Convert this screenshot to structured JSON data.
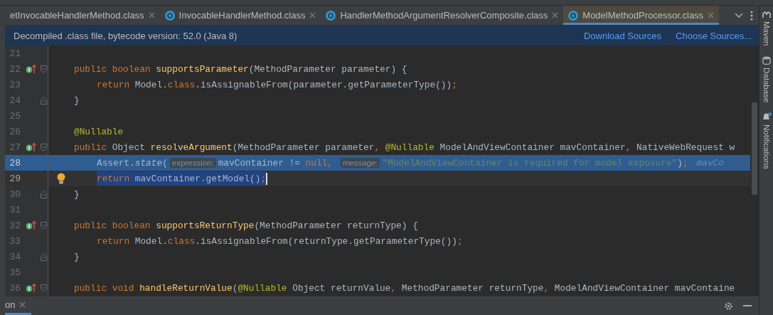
{
  "tabs": [
    {
      "label": "etInvocableHandlerMethod.class",
      "icon": false,
      "selected": false
    },
    {
      "label": "InvocableHandlerMethod.class",
      "icon": true,
      "selected": false
    },
    {
      "label": "HandlerMethodArgumentResolverComposite.class",
      "icon": true,
      "selected": false
    },
    {
      "label": "ModelMethodProcessor.class",
      "icon": true,
      "selected": true
    }
  ],
  "banner": {
    "text": "Decompiled .class file, bytecode version: 52.0 (Java 8)",
    "links": [
      "Download Sources",
      "Choose Sources..."
    ]
  },
  "lines": [
    {
      "number": "21",
      "kind": "plain",
      "override": false,
      "bulb": false,
      "selected": false,
      "caret": false
    },
    {
      "number": "22",
      "kind": "fold-start",
      "override": true,
      "bulb": false,
      "selected": false,
      "caret": false,
      "tokens": [
        {
          "kind": "kw",
          "text": "public boolean "
        },
        {
          "kind": "fn",
          "text": "supportsParameter"
        },
        {
          "kind": "plain",
          "text": "(MethodParameter parameter) {"
        }
      ],
      "children": [
        {
          "number": "23",
          "kind": "plain",
          "override": false,
          "bulb": false,
          "selected": false,
          "caret": false,
          "tokens": [
            {
              "kind": "kw",
              "text": "return "
            },
            {
              "kind": "plain",
              "text": "Model."
            },
            {
              "kind": "kw",
              "text": "class"
            },
            {
              "kind": "plain",
              "text": ".isAssignableFrom(parameter.getParameterType())"
            },
            {
              "kind": "kw",
              "text": ";"
            }
          ]
        }
      ]
    },
    {
      "number": "24",
      "kind": "fold-end",
      "override": false,
      "bulb": false,
      "selected": false,
      "caret": false,
      "tokens": [
        {
          "kind": "plain",
          "text": "}"
        }
      ]
    },
    {
      "number": "25",
      "kind": "plain",
      "override": false,
      "bulb": false,
      "selected": false,
      "caret": false
    },
    {
      "number": "26",
      "kind": "plain",
      "override": false,
      "bulb": false,
      "selected": false,
      "caret": false,
      "tokens": [
        {
          "kind": "ann",
          "text": "@Nullable"
        }
      ]
    },
    {
      "number": "27",
      "kind": "fold-start",
      "override": true,
      "bulb": false,
      "selected": false,
      "caret": false,
      "tokens": [
        {
          "kind": "kw",
          "text": "public "
        },
        {
          "kind": "plain",
          "text": "Object "
        },
        {
          "kind": "fn",
          "text": "resolveArgument"
        },
        {
          "kind": "plain",
          "text": "(MethodParameter parameter"
        },
        {
          "kind": "kw",
          "text": ", "
        },
        {
          "kind": "ann",
          "text": "@Nullable "
        },
        {
          "kind": "plain",
          "text": "ModelAndViewContainer mavContainer"
        },
        {
          "kind": "kw",
          "text": ", "
        },
        {
          "kind": "plain",
          "text": "NativeWebRequest w"
        }
      ],
      "children": [
        {
          "number": "28",
          "kind": "plain",
          "override": false,
          "bulb": false,
          "selected": true,
          "caret": false,
          "tokens": [
            {
              "kind": "plain",
              "text": "Assert."
            },
            {
              "kind": "static",
              "text": "state"
            },
            {
              "kind": "plain",
              "text": "("
            },
            {
              "kind": "hint",
              "text": "expression:"
            },
            {
              "kind": "plain",
              "text": "mavContainer != "
            },
            {
              "kind": "kw",
              "text": "null, "
            },
            {
              "kind": "hint",
              "text": "message:"
            },
            {
              "kind": "str",
              "text": "\"ModelAndViewContainer is required for model exposure\""
            },
            {
              "kind": "plain",
              "text": ")"
            },
            {
              "kind": "kw",
              "text": ";"
            },
            {
              "kind": "value",
              "text": "mavCo"
            }
          ]
        },
        {
          "number": "29",
          "kind": "plain",
          "override": false,
          "bulb": true,
          "selected": false,
          "caret": true,
          "tokens": [
            {
              "kind": "kw",
              "text": "return "
            },
            {
              "kind": "plain",
              "text": "mavContainer.getModel()"
            },
            {
              "kind": "kw",
              "text": ";"
            }
          ]
        }
      ]
    },
    {
      "number": "30",
      "kind": "fold-end",
      "override": false,
      "bulb": false,
      "selected": false,
      "caret": false,
      "tokens": [
        {
          "kind": "plain",
          "text": "}"
        }
      ]
    },
    {
      "number": "31",
      "kind": "plain",
      "override": false,
      "bulb": false,
      "selected": false,
      "caret": false
    },
    {
      "number": "32",
      "kind": "fold-start",
      "override": true,
      "bulb": false,
      "selected": false,
      "caret": false,
      "tokens": [
        {
          "kind": "kw",
          "text": "public boolean "
        },
        {
          "kind": "fn",
          "text": "supportsReturnType"
        },
        {
          "kind": "plain",
          "text": "(MethodParameter returnType) {"
        }
      ],
      "children": [
        {
          "number": "33",
          "kind": "plain",
          "override": false,
          "bulb": false,
          "selected": false,
          "caret": false,
          "tokens": [
            {
              "kind": "kw",
              "text": "return "
            },
            {
              "kind": "plain",
              "text": "Model."
            },
            {
              "kind": "kw",
              "text": "class"
            },
            {
              "kind": "plain",
              "text": ".isAssignableFrom(returnType.getParameterType())"
            },
            {
              "kind": "kw",
              "text": ";"
            }
          ]
        }
      ]
    },
    {
      "number": "34",
      "kind": "fold-end",
      "override": false,
      "bulb": false,
      "selected": false,
      "caret": false,
      "tokens": [
        {
          "kind": "plain",
          "text": "}"
        }
      ]
    },
    {
      "number": "35",
      "kind": "plain",
      "override": false,
      "bulb": false,
      "selected": false,
      "caret": false
    },
    {
      "number": "36",
      "kind": "fold-start",
      "override": true,
      "bulb": false,
      "selected": false,
      "caret": false,
      "tokens": [
        {
          "kind": "kw",
          "text": "public void "
        },
        {
          "kind": "fn",
          "text": "handleReturnValue"
        },
        {
          "kind": "plain",
          "text": "("
        },
        {
          "kind": "ann",
          "text": "@Nullable "
        },
        {
          "kind": "plain",
          "text": "Object returnValue"
        },
        {
          "kind": "kw",
          "text": ", "
        },
        {
          "kind": "plain",
          "text": "MethodParameter returnType"
        },
        {
          "kind": "kw",
          "text": ", "
        },
        {
          "kind": "plain",
          "text": "ModelAndViewContainer mavContaine"
        }
      ]
    }
  ],
  "side_tools": [
    {
      "label": "Maven",
      "kind": "maven"
    },
    {
      "label": "Database",
      "kind": "database"
    },
    {
      "label": "Notifications",
      "kind": "bell"
    }
  ],
  "bottom_panel": {
    "tab": "on"
  }
}
